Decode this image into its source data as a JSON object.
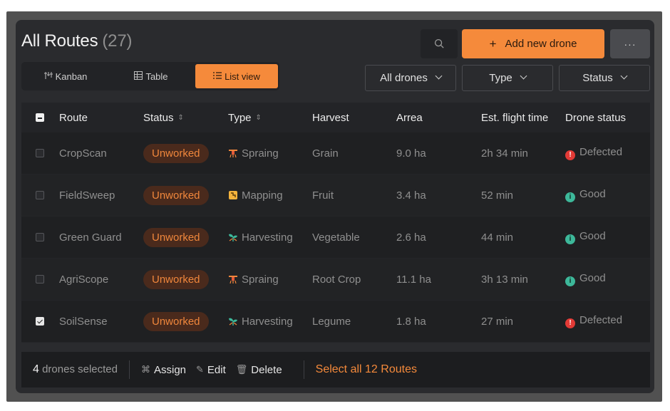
{
  "header": {
    "title": "All Routes",
    "count": "(27)"
  },
  "toolbar": {
    "search_icon": "search-icon",
    "add_label": "Add new drone",
    "more_label": "···"
  },
  "views": [
    {
      "label": "Kanban",
      "icon": "kanban-icon",
      "active": false
    },
    {
      "label": "Table",
      "icon": "table-icon",
      "active": false
    },
    {
      "label": "List view",
      "icon": "list-icon",
      "active": true
    }
  ],
  "filters": [
    {
      "label": "All drones"
    },
    {
      "label": "Type"
    },
    {
      "label": "Status"
    }
  ],
  "columns": [
    "Route",
    "Status",
    "Type",
    "Harvest",
    "Arrea",
    "Est. flight time",
    "Drone status"
  ],
  "rows": [
    {
      "checked": false,
      "route": "CropScan",
      "status": "Unworked",
      "type": "Spraing",
      "type_icon": "spraying-drone-icon",
      "harvest": "Grain",
      "area": "9.0 ha",
      "time": "2h 34 min",
      "drone": "Defected",
      "drone_icon": "alert-icon"
    },
    {
      "checked": false,
      "route": "FieldSweep",
      "status": "Unworked",
      "type": "Mapping",
      "type_icon": "map-icon",
      "harvest": "Fruit",
      "area": "3.4 ha",
      "time": "52 min",
      "drone": "Good",
      "drone_icon": "info-icon"
    },
    {
      "checked": false,
      "route": "Green Guard",
      "status": "Unworked",
      "type": "Harvesting",
      "type_icon": "sprout-icon",
      "harvest": "Vegetable",
      "area": "2.6 ha",
      "time": "44 min",
      "drone": "Good",
      "drone_icon": "info-icon"
    },
    {
      "checked": false,
      "route": "AgriScope",
      "status": "Unworked",
      "type": "Spraing",
      "type_icon": "spraying-drone-icon",
      "harvest": "Root Crop",
      "area": "11.1 ha",
      "time": "3h 13 min",
      "drone": "Good",
      "drone_icon": "info-icon"
    },
    {
      "checked": true,
      "route": "SoilSense",
      "status": "Unworked",
      "type": "Harvesting",
      "type_icon": "sprout-icon",
      "harvest": "Legume",
      "area": "1.8 ha",
      "time": "27 min",
      "drone": "Defected",
      "drone_icon": "alert-icon"
    }
  ],
  "footer": {
    "selected_count": "4",
    "selected_text": "drones selected",
    "assign_label": "Assign",
    "edit_label": "Edit",
    "delete_label": "Delete",
    "select_all_label": "Select all 12 Routes"
  },
  "colors": {
    "accent": "#f58a3b",
    "defected": "#e23a36",
    "good": "#3db89a"
  }
}
